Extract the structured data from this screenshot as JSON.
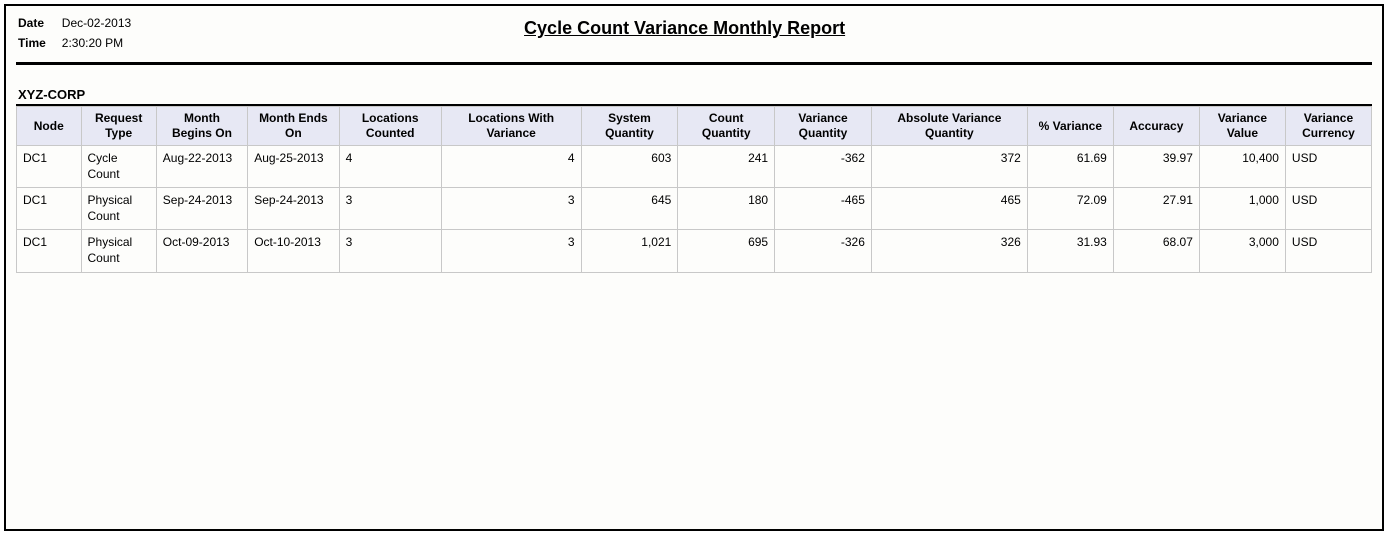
{
  "meta": {
    "date_label": "Date",
    "date_value": "Dec-02-2013",
    "time_label": "Time",
    "time_value": "2:30:20 PM"
  },
  "title": "Cycle Count Variance Monthly Report",
  "corp": "XYZ-CORP",
  "columns": [
    "Node",
    "Request Type",
    "Month Begins On",
    "Month Ends On",
    "Locations Counted",
    "Locations With Variance",
    "System Quantity",
    "Count Quantity",
    "Variance Quantity",
    "Absolute Variance Quantity",
    "% Variance",
    "Accuracy",
    "Variance Value",
    "Variance Currency"
  ],
  "rows": [
    {
      "node": "DC1",
      "request_type": "Cycle Count",
      "month_begins": "Aug-22-2013",
      "month_ends": "Aug-25-2013",
      "locations_counted": "4",
      "locations_with_variance": "4",
      "system_quantity": "603",
      "count_quantity": "241",
      "variance_quantity": "-362",
      "absolute_variance_quantity": "372",
      "pct_variance": "61.69",
      "accuracy": "39.97",
      "variance_value": "10,400",
      "variance_currency": "USD"
    },
    {
      "node": "DC1",
      "request_type": "Physical Count",
      "month_begins": "Sep-24-2013",
      "month_ends": "Sep-24-2013",
      "locations_counted": "3",
      "locations_with_variance": "3",
      "system_quantity": "645",
      "count_quantity": "180",
      "variance_quantity": "-465",
      "absolute_variance_quantity": "465",
      "pct_variance": "72.09",
      "accuracy": "27.91",
      "variance_value": "1,000",
      "variance_currency": "USD"
    },
    {
      "node": "DC1",
      "request_type": "Physical Count",
      "month_begins": "Oct-09-2013",
      "month_ends": "Oct-10-2013",
      "locations_counted": "3",
      "locations_with_variance": "3",
      "system_quantity": "1,021",
      "count_quantity": "695",
      "variance_quantity": "-326",
      "absolute_variance_quantity": "326",
      "pct_variance": "31.93",
      "accuracy": "68.07",
      "variance_value": "3,000",
      "variance_currency": "USD"
    }
  ]
}
